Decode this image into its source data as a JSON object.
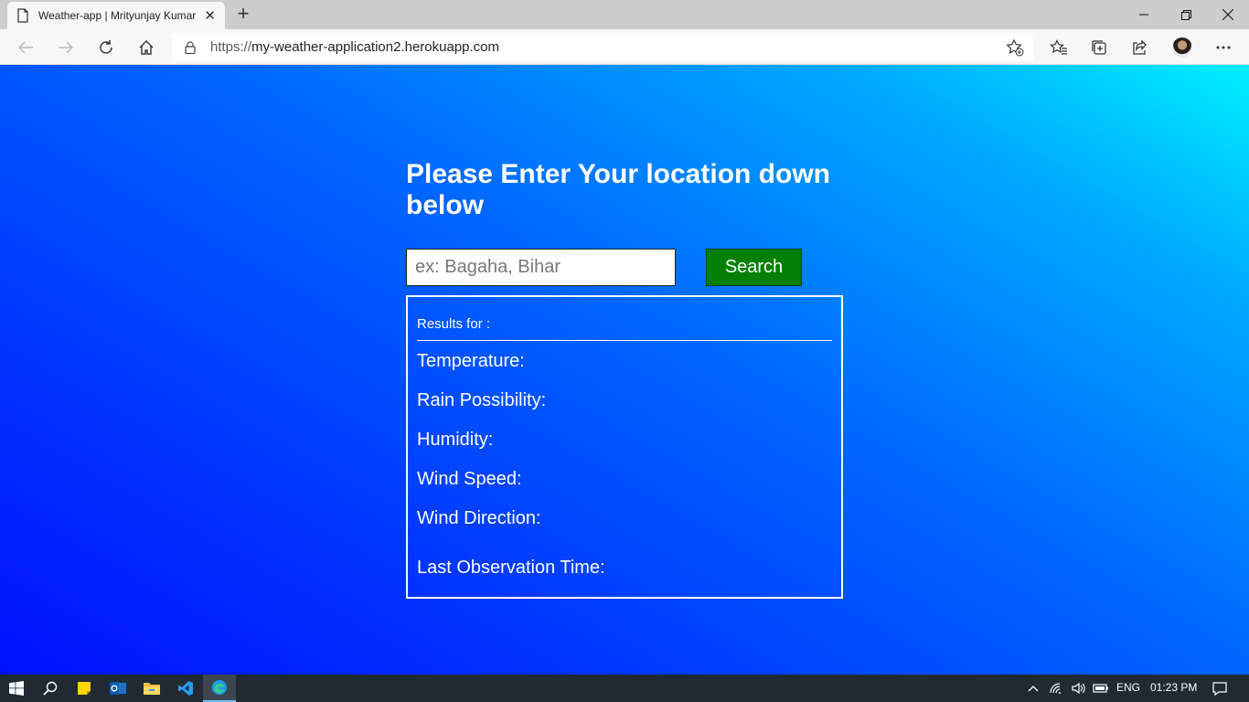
{
  "browser": {
    "tab_title": "Weather-app | Mrityunjay Kumar",
    "url_scheme": "https://",
    "url_host": "my-weather-application2.herokuapp.com"
  },
  "page": {
    "heading": "Please Enter Your location down below",
    "search_placeholder": "ex: Bagaha, Bihar",
    "search_value": "",
    "search_button": "Search",
    "results_for": "Results for :",
    "rows": {
      "temperature": "Temperature:",
      "rain": "Rain Possibility:",
      "humidity": "Humidity:",
      "wind_speed": "Wind Speed:",
      "wind_direction": "Wind Direction:",
      "last_observation": "Last Observation Time:"
    }
  },
  "taskbar": {
    "language": "ENG",
    "time": "01:23 PM"
  },
  "colors": {
    "search_button_bg": "#038003",
    "gradient_top_right": "#00f0ff",
    "gradient_bottom_left": "#0010ff"
  }
}
